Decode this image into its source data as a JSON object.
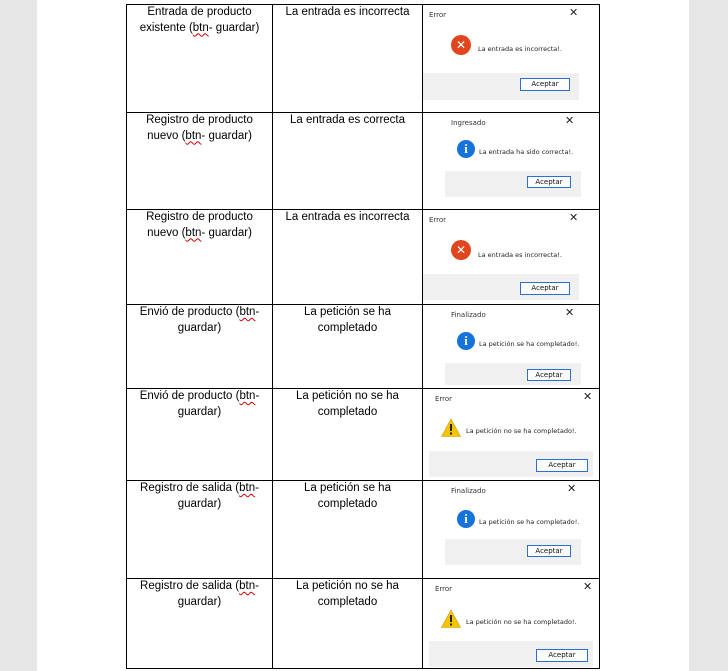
{
  "rows": [
    {
      "col1_pre": "Entrada de producto existente (",
      "col1_btn": "btn",
      "col1_post": "- guardar)",
      "col2": "La entrada es incorrecta",
      "dialog": {
        "title": "Error",
        "icon": "error-icon",
        "message": "La entrada es incorrecta!.",
        "button": "Aceptar"
      }
    },
    {
      "col1_pre": "Registro de producto nuevo (",
      "col1_btn": "btn",
      "col1_post": "- guardar)",
      "col2": "La entrada es correcta",
      "dialog": {
        "title": "Ingresado",
        "icon": "info-icon",
        "message": "La entrada ha sido correcta!.",
        "button": "Aceptar"
      }
    },
    {
      "col1_pre": "Registro de producto nuevo (",
      "col1_btn": "btn",
      "col1_post": "- guardar)",
      "col2": "La entrada es incorrecta",
      "dialog": {
        "title": "Error",
        "icon": "error-icon",
        "message": "La entrada es incorrecta!.",
        "button": "Aceptar"
      }
    },
    {
      "col1_pre": "Envió de producto (",
      "col1_btn": "btn",
      "col1_post": "- guardar)",
      "col2": "La petición se ha completado",
      "dialog": {
        "title": "Finalizado",
        "icon": "info-icon",
        "message": "La petición se ha completado!.",
        "button": "Aceptar"
      }
    },
    {
      "col1_pre": "Envió de producto (",
      "col1_btn": "btn",
      "col1_post": "- guardar)",
      "col2": "La petición no se ha completado",
      "dialog": {
        "title": "Error",
        "icon": "warning-icon",
        "message": "La petición no se ha completado!.",
        "button": "Aceptar"
      }
    },
    {
      "col1_pre": "Registro de salida (",
      "col1_btn": "btn",
      "col1_post": "- guardar)",
      "col2": "La petición se ha completado",
      "dialog": {
        "title": "Finalizado",
        "icon": "info-icon",
        "message": "La petición se ha completado!.",
        "button": "Aceptar"
      }
    },
    {
      "col1_pre": "Registro de salida (",
      "col1_btn": "btn",
      "col1_post": "- guardar)",
      "col2": "La petición no se ha completado",
      "dialog": {
        "title": "Error",
        "icon": "warning-icon",
        "message": "La petición no se ha completado!.",
        "button": "Aceptar"
      }
    }
  ],
  "colors": {
    "error": "#e0461e",
    "info": "#1673d9",
    "warning": "#f5c400",
    "button_border": "#2b6fd6",
    "footer": "#f0f0f0"
  }
}
